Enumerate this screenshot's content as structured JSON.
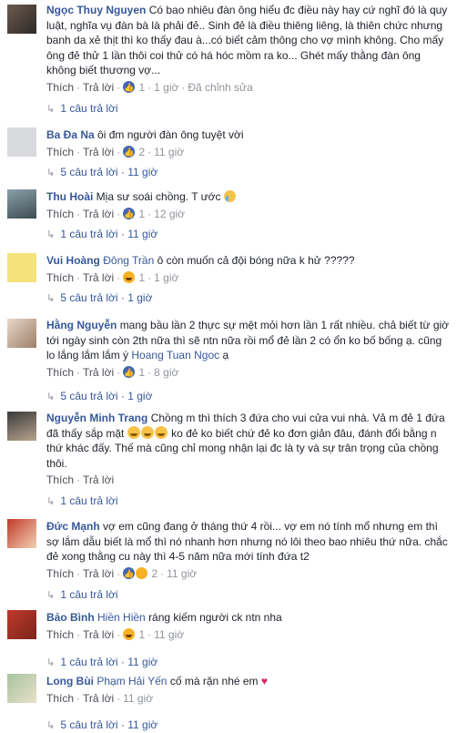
{
  "actions": {
    "like": "Thích",
    "reply": "Trả lời",
    "edited": "Đã chỉnh sửa"
  },
  "comments": [
    {
      "author": "Ngọc Thuy Nguyen",
      "text": "Có bao nhiêu đàn ông hiểu đc điều này hay cứ nghĩ đó là quy luật, nghĩa vụ đàn bà là phải đẻ.. Sinh đẻ là điều thiêng liêng, là thiên chức nhưng banh da xẻ thịt thì ko thấy đau à...có biết cảm thông cho vợ mình không. Cho mấy ông đẻ thử 1 lần thôi coi thử có há hóc mồm ra ko... Ghét mấy thằng đàn ông không biết thương vợ...",
      "likes": "1",
      "time": "1 giờ",
      "replies": "1 câu trả lời"
    },
    {
      "author": "Ba Đa Na",
      "text": "ôi đm người đàn ông tuyệt vời",
      "likes": "2",
      "time": "11 giờ",
      "replies": "5 câu trả lời · 11 giờ"
    },
    {
      "author": "Thu Hoài",
      "text": "Mịa sư soái chồng. T ước",
      "likes": "1",
      "time": "12 giờ",
      "replies": "1 câu trả lời · 11 giờ"
    },
    {
      "author": "Vui Hoàng",
      "mention": "Đông Trần",
      "text": "ô còn muốn cả đội bóng nữa k hử ?????",
      "likes": "1",
      "time": "1 giờ",
      "replies": "5 câu trả lời · 1 giờ"
    },
    {
      "author": "Hằng Nguyễn",
      "text": "mang bầu lần 2 thực sự mệt mỏi hơn lần 1 rất nhiều. chả biết từ giờ tới ngày sinh còn 2th nữa thì sẽ ntn nữa rồi mổ đẻ lần 2 có ổn ko bố bống ạ. cũng lo lắng lắm lắm ý",
      "mention": "Hoang Tuan Ngoc",
      "text_end": "ạ",
      "likes": "1",
      "time": "8 giờ",
      "replies": "5 câu trả lời · 1 giờ"
    },
    {
      "author": "Nguyễn Minh Trang",
      "text_a": "Chồng m thì thích 3 đứa cho vui cửa vui nhà. Vả m đẻ 1 đứa đã thấy sắp mặt",
      "text_b": "ko đẻ ko biết chứ đẻ ko đơn giản đâu, đánh đổi bằng n thứ khác đấy. Thế mà cũng chỉ mong nhận lại đc là ty và sự trân trọng của chồng thôi.",
      "replies": "1 câu trả lời"
    },
    {
      "author": "Đức Mạnh",
      "text": "vợ em cũng đang ở tháng thứ 4 rồi... vợ em nó tính mổ nhưng em thì sợ lắm dẫu biết là mổ thì nó nhanh hơn nhưng nó lôi theo bao nhiêu thứ nữa. chắc đẻ xong thằng cu này thì 4-5 năm nữa mới tính đứa t2",
      "likes": "2",
      "time": "11 giờ",
      "replies": "1 câu trả lời"
    },
    {
      "author": "Bảo Bình",
      "mention": "Hiền Hiền",
      "text": "ráng kiếm người ck ntn nha",
      "likes": "1",
      "time": "11 giờ",
      "replies": "1 câu trả lời · 11 giờ"
    },
    {
      "author": "Long Bùi",
      "mention": "Phạm Hải Yến",
      "text": "cố mà rặn nhé em",
      "time": "11 giờ",
      "replies": "5 câu trả lời · 11 giờ"
    }
  ],
  "colors": {
    "link": "#365899",
    "meta": "#90949c",
    "like_blue": "#4267b2",
    "heart": "#e0245e"
  }
}
